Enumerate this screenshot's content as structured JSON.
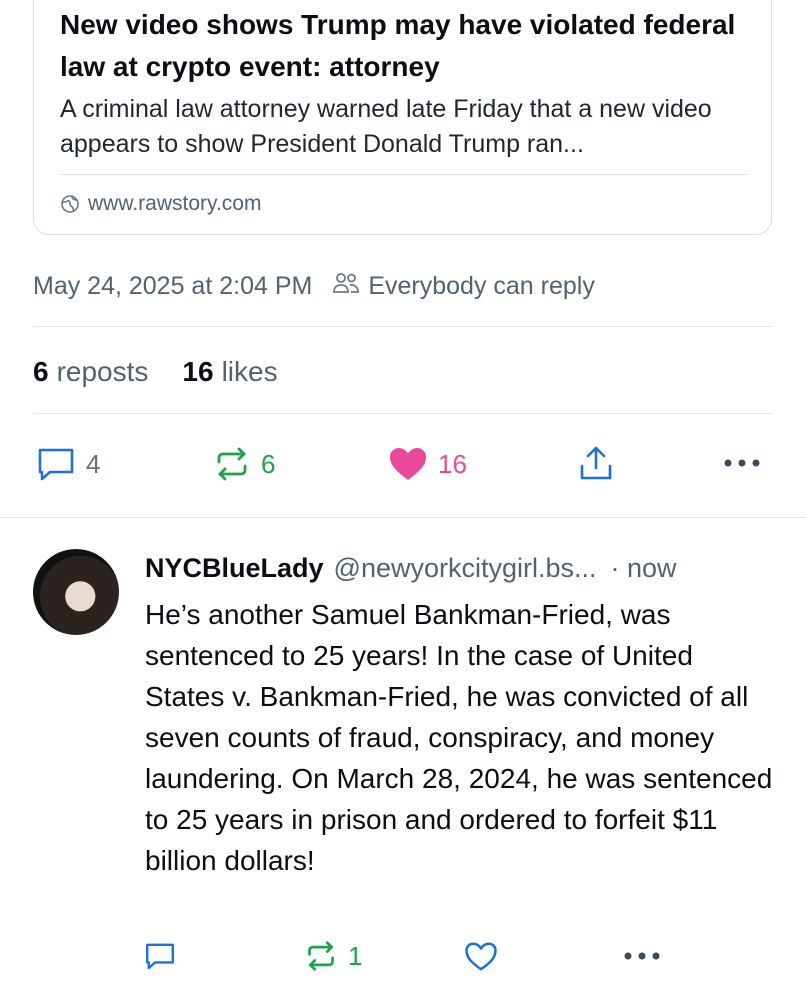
{
  "link_card": {
    "title": "New video shows Trump may have violated federal law at crypto event: attorney",
    "description": "A criminal law attorney warned late Friday that a new video appears to show President Donald Trump ran...",
    "domain": "www.rawstory.com"
  },
  "post_meta": {
    "timestamp": "May 24, 2025 at 2:04 PM",
    "reply_setting": "Everybody can reply"
  },
  "engagement": {
    "reposts_count": "6",
    "reposts_label": "reposts",
    "likes_count": "16",
    "likes_label": "likes"
  },
  "main_actions": {
    "reply_count": "4",
    "repost_count": "6",
    "like_count": "16"
  },
  "reply": {
    "display_name": "NYCBlueLady",
    "handle": "@newyorkcitygirl.bs...",
    "time": "· now",
    "text": "He’s another Samuel Bankman-Fried, was sentenced to 25 years! In the case of United States v. Bankman-Fried, he was convicted of all seven counts of fraud, conspiracy, and money laundering. On March 28, 2024, he was sentenced to 25 years in prison and ordered to forfeit $11 billion dollars!",
    "repost_count": "1"
  },
  "colors": {
    "repost_green": "#1ea34a",
    "like_pink": "#ec4899",
    "icon_gray": "#5f7082",
    "reply_blue": "#1d6fe0"
  },
  "icons": {
    "reply": "comment-bubble-icon",
    "repost": "repost-arrows-icon",
    "like": "heart-icon",
    "share": "share-upload-icon",
    "more": "ellipsis-icon",
    "globe": "globe-icon",
    "people": "people-icon"
  }
}
